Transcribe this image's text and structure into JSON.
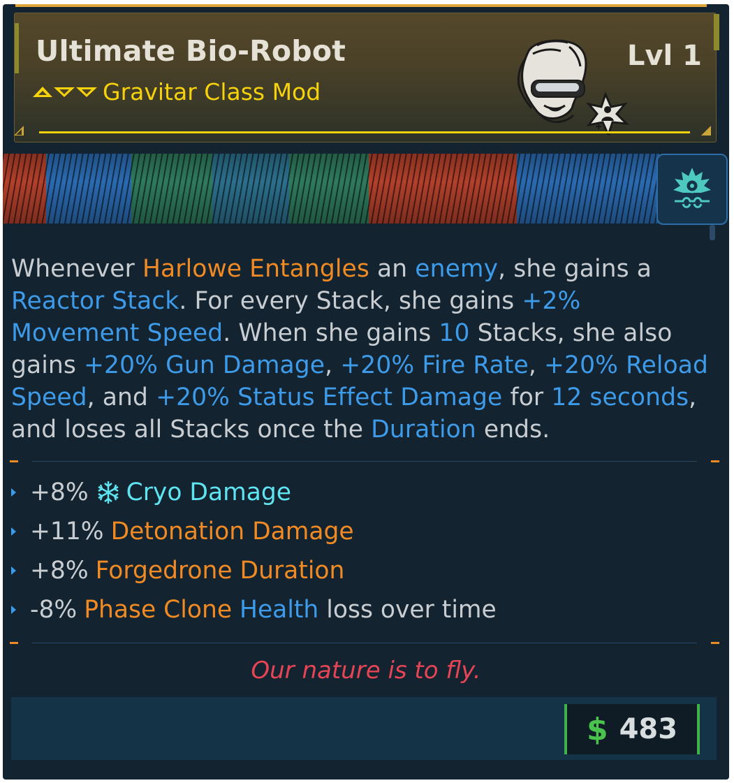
{
  "item": {
    "name": "Ultimate Bio-Robot",
    "type": "Gravitar Class Mod",
    "level": "Lvl 1",
    "rarity_color": "#f5d20c"
  },
  "description": [
    {
      "text": "Whenever ",
      "c": "w"
    },
    {
      "text": "Harlowe Entangles",
      "c": "o"
    },
    {
      "text": " an ",
      "c": "w"
    },
    {
      "text": "enemy",
      "c": "b"
    },
    {
      "text": ", she gains a ",
      "c": "w"
    },
    {
      "text": "Reactor Stack",
      "c": "b"
    },
    {
      "text": ". For every Stack, she gains ",
      "c": "w"
    },
    {
      "text": "+2% Movement Speed",
      "c": "b"
    },
    {
      "text": ". When she gains ",
      "c": "w"
    },
    {
      "text": "10",
      "c": "b"
    },
    {
      "text": " Stacks, she also gains ",
      "c": "w"
    },
    {
      "text": "+20% Gun Damage",
      "c": "b"
    },
    {
      "text": ", ",
      "c": "w"
    },
    {
      "text": "+20% Fire Rate",
      "c": "b"
    },
    {
      "text": ", ",
      "c": "w"
    },
    {
      "text": "+20% Reload Speed",
      "c": "b"
    },
    {
      "text": ", and ",
      "c": "w"
    },
    {
      "text": "+20% Status Effect Damage",
      "c": "b"
    },
    {
      "text": " for ",
      "c": "w"
    },
    {
      "text": "12 seconds",
      "c": "b"
    },
    {
      "text": ", and loses all Stacks once the ",
      "c": "w"
    },
    {
      "text": "Duration",
      "c": "b"
    },
    {
      "text": " ends.",
      "c": "w"
    }
  ],
  "stats": {
    "cryo": {
      "value": "+8%",
      "label": "Cryo Damage",
      "icon": "snowflake-icon"
    },
    "detonation": {
      "value": "+11%",
      "label": "Detonation Damage"
    },
    "forgedrone": {
      "value": "+8%",
      "label": "Forgedrone Duration"
    },
    "phase": {
      "value": "-8%",
      "label_a": "Phase Clone",
      "label_b": "Health",
      "label_c": "loss over time"
    }
  },
  "flavor_text": "Our nature is to fly.",
  "price": {
    "currency_symbol": "$",
    "amount": "483",
    "currency_color": "#49c24e"
  },
  "colors": {
    "orange": "#f08a24",
    "blue": "#3d9be9",
    "cryo": "#5fe4f2",
    "flavor": "#e64555"
  }
}
